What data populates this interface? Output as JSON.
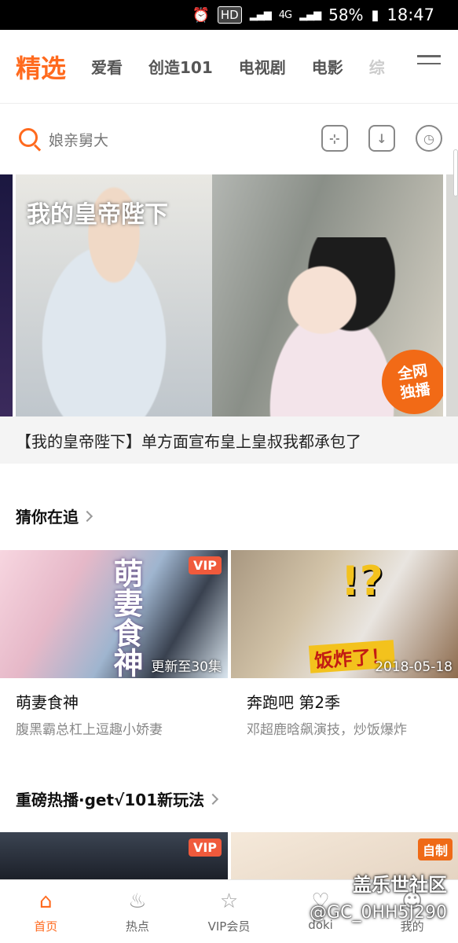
{
  "status_bar": {
    "hd": "HD",
    "network": "4G",
    "battery": "58%",
    "time": "18:47"
  },
  "top_nav": {
    "tabs": [
      "精选",
      "爱看",
      "创造101",
      "电视剧",
      "电影",
      "综"
    ]
  },
  "search": {
    "placeholder": "娘亲舅大"
  },
  "banner": {
    "logo_text": "我的皇帝陛下",
    "badge_line1": "全网",
    "badge_line2": "独播",
    "caption": "【我的皇帝陛下】单方面宣布皇上皇叔我都承包了"
  },
  "section1": {
    "title": "猜你在追",
    "cards": [
      {
        "title": "萌妻食神",
        "desc": "腹黑霸总杠上逗趣小娇妻",
        "badge": "VIP",
        "overlay": "更新至30集",
        "logo_text": "萌妻食神"
      },
      {
        "title": "奔跑吧 第2季",
        "desc": "邓超鹿晗飙演技，炒饭爆炸",
        "overlay": "2018-05-18",
        "caption_text": "饭炸了！",
        "mark_text": "!?"
      }
    ]
  },
  "section2": {
    "title": "重磅热播·get√101新玩法",
    "cards": [
      {
        "badge": "VIP"
      },
      {
        "badge": "自制"
      }
    ]
  },
  "bottom_nav": {
    "items": [
      {
        "label": "首页",
        "icon": "home-icon"
      },
      {
        "label": "热点",
        "icon": "flame-icon"
      },
      {
        "label": "VIP会员",
        "icon": "vip-star-icon"
      },
      {
        "label": "doki",
        "icon": "doki-heart-icon"
      },
      {
        "label": "我的",
        "icon": "profile-face-icon"
      }
    ]
  },
  "watermark": {
    "line1": "盖乐世社区",
    "line2": "@GC_0HH5J290"
  },
  "colors": {
    "accent": "#ff6a1e",
    "vip_badge": "#f05a3c"
  }
}
